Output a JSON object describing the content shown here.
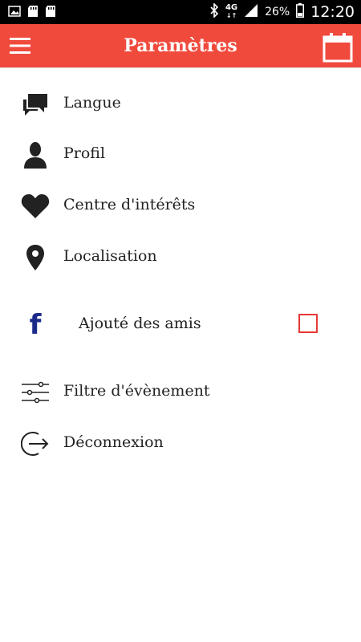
{
  "status_bar": {
    "network": "4G",
    "battery_percent": "26%",
    "time": "12:20"
  },
  "app_bar": {
    "title": "Paramètres",
    "left_icon": "hamburger-menu-icon",
    "right_icon": "calendar-icon",
    "color": "#f04a3d"
  },
  "settings": {
    "items": [
      {
        "label": "Langue",
        "icon": "chat-bubbles-icon"
      },
      {
        "label": "Profil",
        "icon": "person-icon"
      },
      {
        "label": "Centre d'intérêts",
        "icon": "heart-icon"
      },
      {
        "label": "Localisation",
        "icon": "location-pin-icon"
      }
    ],
    "facebook": {
      "icon_letter": "f",
      "label": "Ajouté des amis",
      "checked": false
    },
    "bottom_items": [
      {
        "label": "Filtre d'évènement",
        "icon": "sliders-icon"
      },
      {
        "label": "Déconnexion",
        "icon": "logout-icon"
      }
    ]
  }
}
